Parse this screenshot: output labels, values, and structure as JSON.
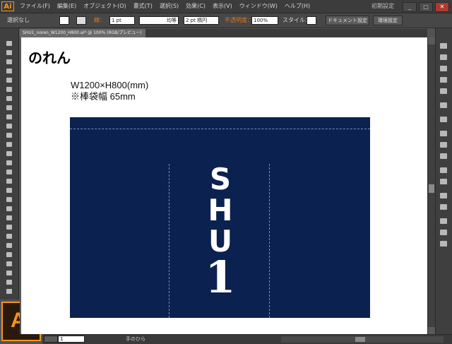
{
  "app": {
    "badge": "Ai",
    "workspace": "初期設定"
  },
  "menu": [
    "ファイル(F)",
    "編集(E)",
    "オブジェクト(O)",
    "書式(T)",
    "選択(S)",
    "効果(C)",
    "表示(V)",
    "ウィンドウ(W)",
    "ヘルプ(H)"
  ],
  "window_buttons": [
    "_",
    "□",
    "✕"
  ],
  "control": {
    "selection": "選択なし",
    "stroke_label": "線：",
    "stroke_weight": "1 pt",
    "stroke_profile": "均等",
    "brush": "2 pt 楕円",
    "opacity_label": "不透明度：",
    "opacity_value": "100%",
    "style_label": "スタイル：",
    "doc_setup": "ドキュメント設定",
    "prefs": "環境設定"
  },
  "doc_tab": "SHU1_noren_W1200_H800.ai* @ 100% (RGB/プレビュー)",
  "artboard": {
    "title": "のれん",
    "size_text": "W1200×H800(mm)",
    "pocket_text": "※棒袋幅 65mm",
    "logo_letters": [
      "S",
      "H",
      "U"
    ],
    "logo_number": "1",
    "noren_color": "#0b2150"
  },
  "status": {
    "page": "1",
    "tool_name": "手のひら"
  },
  "colors": {
    "accent": "#f7941d",
    "ui_dark": "#3c3c3c"
  }
}
